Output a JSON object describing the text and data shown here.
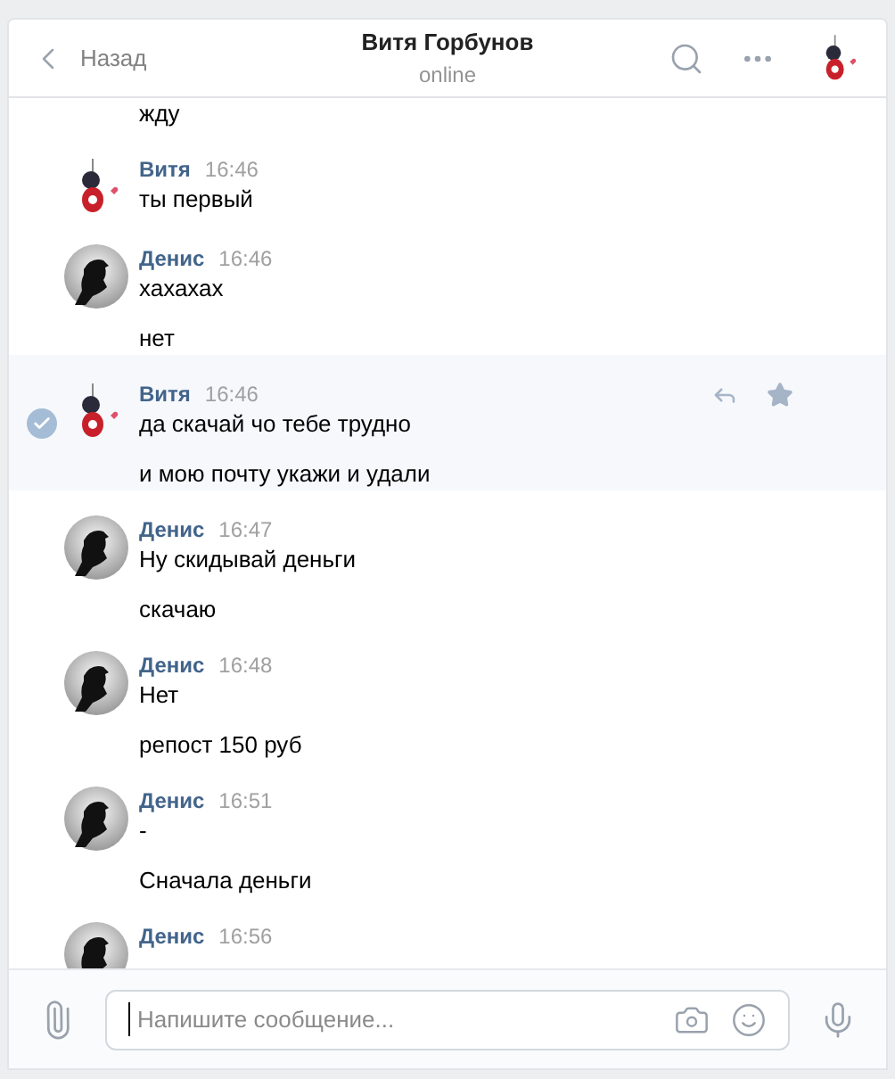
{
  "header": {
    "back": "Назад",
    "title": "Витя Горбунов",
    "status": "online"
  },
  "groups": [
    {
      "messages": [
        "жду"
      ]
    },
    {
      "author": "Витя",
      "time": "16:46",
      "kind": "vitya",
      "selected": false,
      "messages": [
        "ты первый"
      ]
    },
    {
      "author": "Денис",
      "time": "16:46",
      "kind": "denis",
      "selected": false,
      "messages": [
        "хахахах",
        "нет"
      ]
    },
    {
      "author": "Витя",
      "time": "16:46",
      "kind": "vitya",
      "selected": true,
      "messages": [
        "да скачай чо тебе трудно",
        "и мою почту укажи и удали"
      ]
    },
    {
      "author": "Денис",
      "time": "16:47",
      "kind": "denis",
      "selected": false,
      "messages": [
        "Ну скидывай деньги",
        "скачаю"
      ]
    },
    {
      "author": "Денис",
      "time": "16:48",
      "kind": "denis",
      "selected": false,
      "messages": [
        "Нет",
        "репост 150 руб"
      ]
    },
    {
      "author": "Денис",
      "time": "16:51",
      "kind": "denis",
      "selected": false,
      "messages": [
        "-",
        "Сначала деньги"
      ]
    },
    {
      "author": "Денис",
      "time": "16:56",
      "kind": "denis",
      "selected": false
    }
  ],
  "composer": {
    "placeholder": "Напишите сообщение..."
  }
}
